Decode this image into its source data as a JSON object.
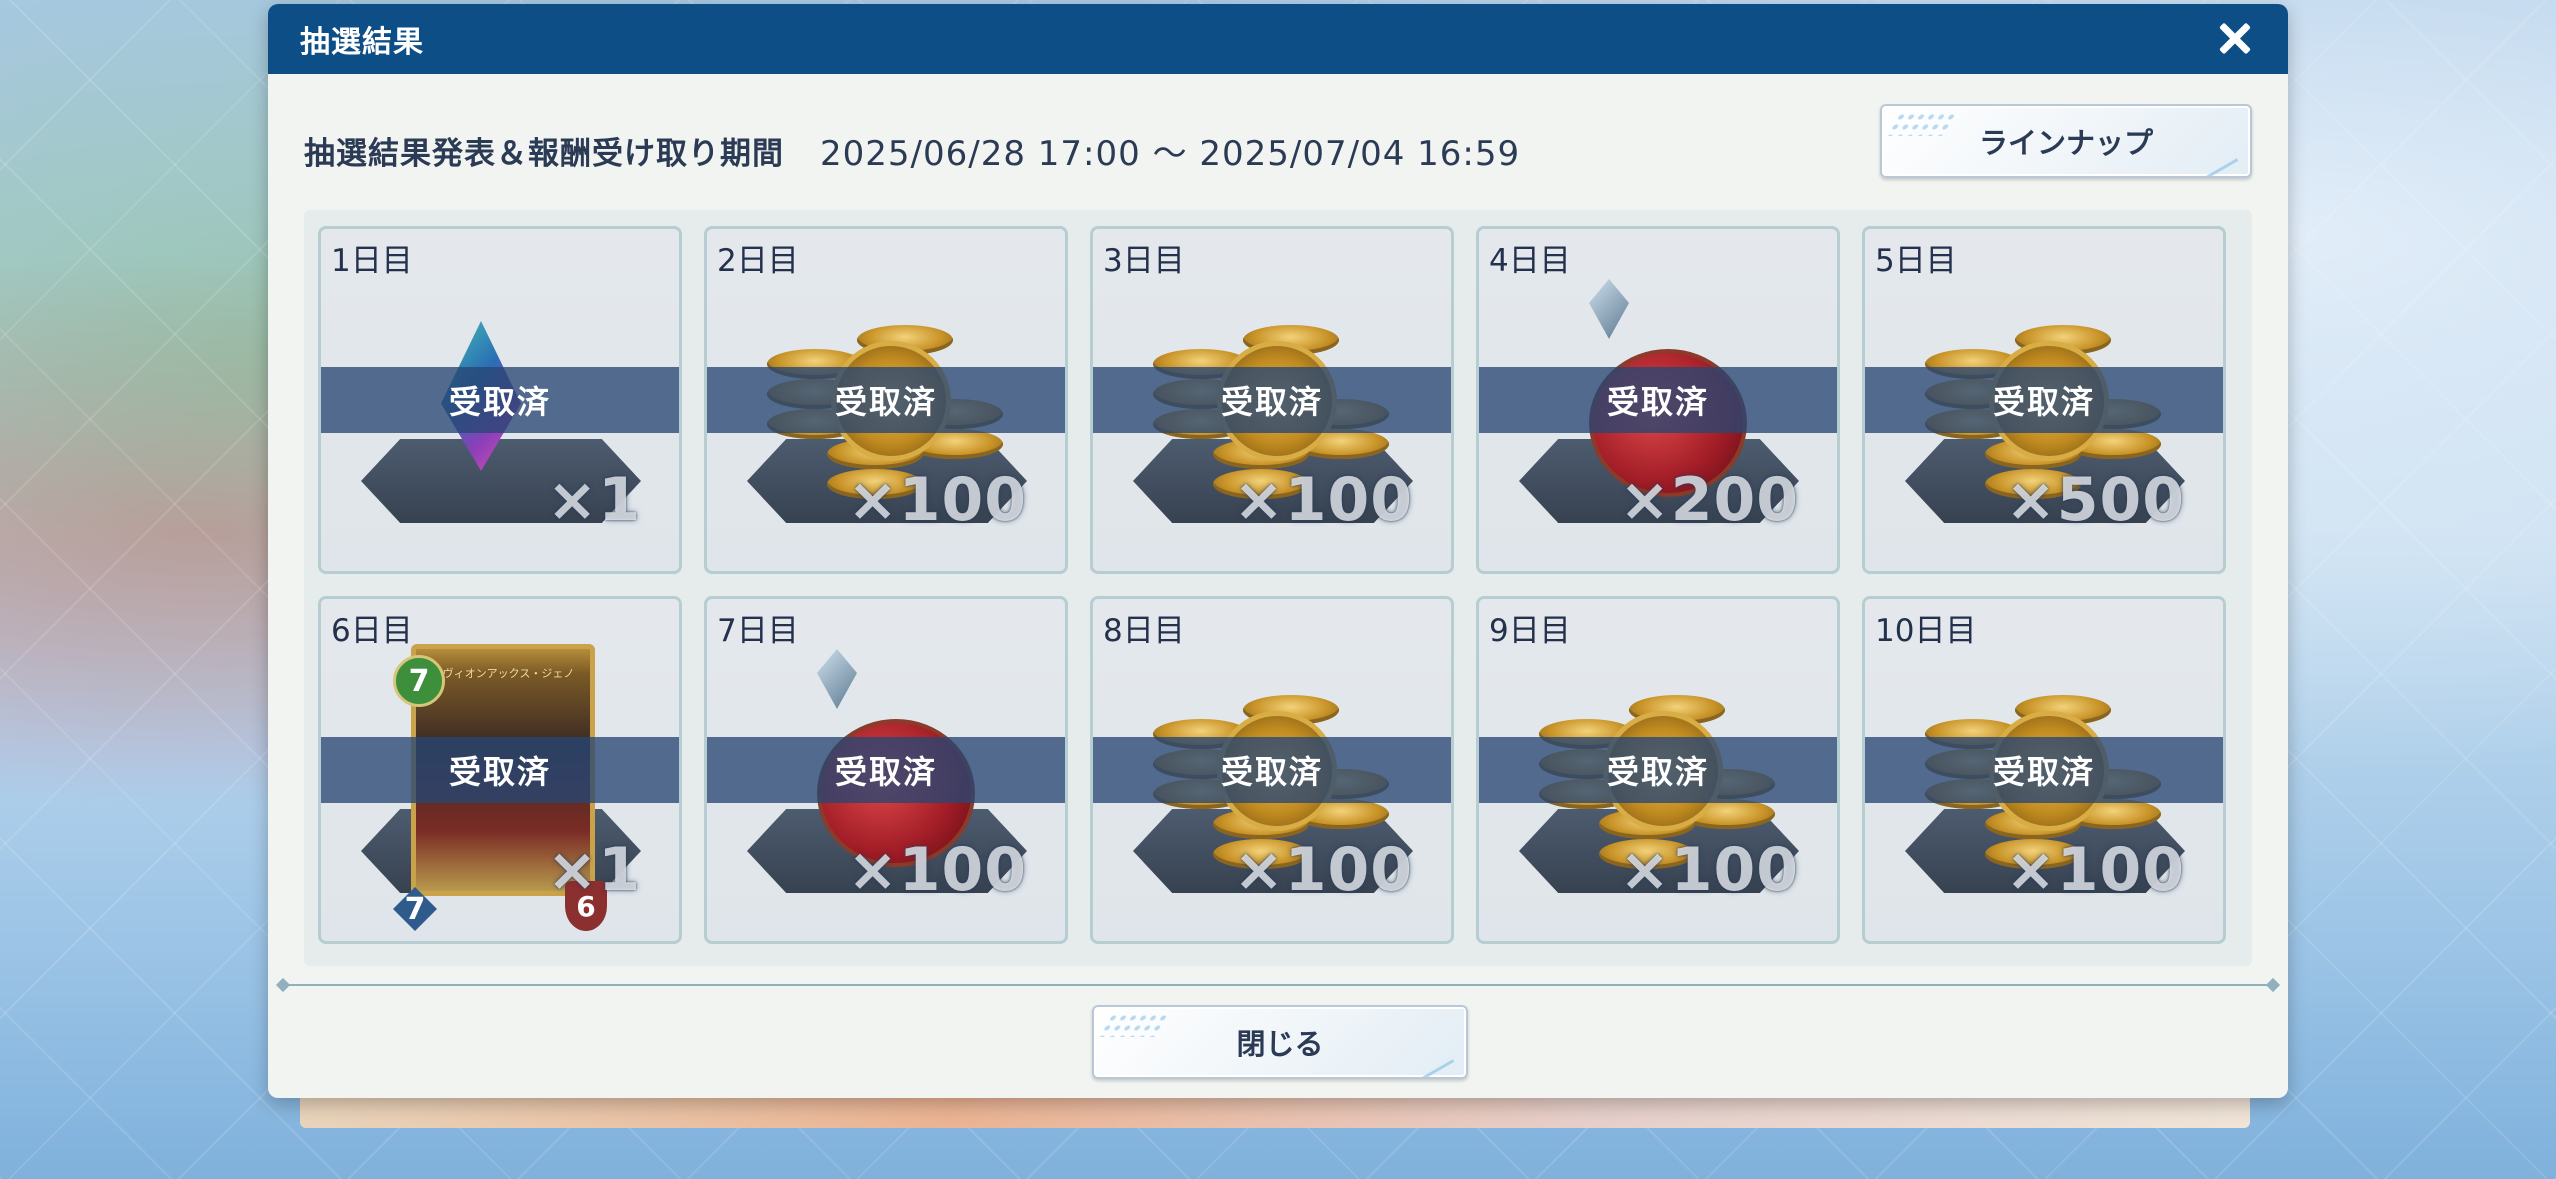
{
  "dialog": {
    "title": "抽選結果",
    "period_label": "抽選結果発表＆報酬受け取り期間",
    "period_value": "2025/06/28 17:00 ～ 2025/07/04 16:59",
    "lineup_button": "ラインナップ",
    "close_button": "閉じる"
  },
  "rewards": [
    {
      "day": "1日目",
      "status": "受取済",
      "quantity": "×1",
      "item": "crystal-icon"
    },
    {
      "day": "2日目",
      "status": "受取済",
      "quantity": "×100",
      "item": "coins-icon"
    },
    {
      "day": "3日目",
      "status": "受取済",
      "quantity": "×100",
      "item": "coins-icon"
    },
    {
      "day": "4日目",
      "status": "受取済",
      "quantity": "×200",
      "item": "potion-icon"
    },
    {
      "day": "5日目",
      "status": "受取済",
      "quantity": "×500",
      "item": "coins-icon"
    },
    {
      "day": "6日目",
      "status": "受取済",
      "quantity": "×1",
      "item": "card-icon",
      "card": {
        "cost": "7",
        "attack": "7",
        "defense": "6",
        "name": "レヴィオンアックス・ジェノ"
      }
    },
    {
      "day": "7日目",
      "status": "受取済",
      "quantity": "×100",
      "item": "potion-icon"
    },
    {
      "day": "8日目",
      "status": "受取済",
      "quantity": "×100",
      "item": "coins-icon"
    },
    {
      "day": "9日目",
      "status": "受取済",
      "quantity": "×100",
      "item": "coins-icon"
    },
    {
      "day": "10日目",
      "status": "受取済",
      "quantity": "×100",
      "item": "coins-icon"
    }
  ],
  "colors": {
    "header": "#0d4e86",
    "status_band": "#284673",
    "panel": "#f2f4f1"
  }
}
